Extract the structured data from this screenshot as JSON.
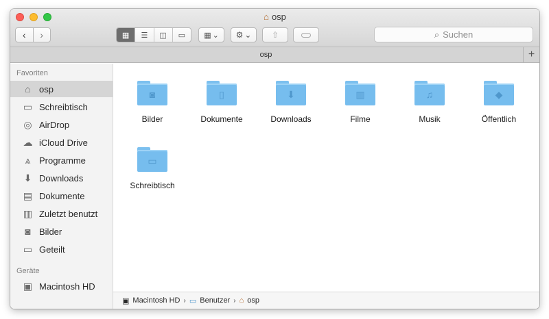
{
  "window": {
    "title": "osp"
  },
  "toolbar": {
    "back_glyph": "‹",
    "forward_glyph": "›",
    "search_placeholder": "Suchen"
  },
  "tabbar": {
    "label": "osp",
    "add_glyph": "+"
  },
  "sidebar": {
    "favorites_heading": "Favoriten",
    "devices_heading": "Geräte",
    "items": [
      {
        "label": "osp",
        "icon": "home-icon"
      },
      {
        "label": "Schreibtisch",
        "icon": "desktop-icon"
      },
      {
        "label": "AirDrop",
        "icon": "airdrop-icon"
      },
      {
        "label": "iCloud Drive",
        "icon": "cloud-icon"
      },
      {
        "label": "Programme",
        "icon": "applications-icon"
      },
      {
        "label": "Downloads",
        "icon": "downloads-icon"
      },
      {
        "label": "Dokumente",
        "icon": "documents-icon"
      },
      {
        "label": "Zuletzt benutzt",
        "icon": "recents-icon"
      },
      {
        "label": "Bilder",
        "icon": "camera-icon"
      },
      {
        "label": "Geteilt",
        "icon": "folder-icon"
      }
    ],
    "devices": [
      {
        "label": "Macintosh HD",
        "icon": "harddisk-icon"
      }
    ]
  },
  "content": {
    "items": [
      {
        "label": "Bilder",
        "icon": "camera-folder-icon"
      },
      {
        "label": "Dokumente",
        "icon": "document-folder-icon"
      },
      {
        "label": "Downloads",
        "icon": "download-folder-icon"
      },
      {
        "label": "Filme",
        "icon": "film-folder-icon"
      },
      {
        "label": "Musik",
        "icon": "music-folder-icon"
      },
      {
        "label": "Öffentlich",
        "icon": "public-folder-icon"
      },
      {
        "label": "Schreibtisch",
        "icon": "desktop-folder-icon"
      }
    ]
  },
  "pathbar": {
    "segments": [
      "Macintosh HD",
      "Benutzer",
      "osp"
    ]
  },
  "colors": {
    "folder": "#76bdee",
    "selection": "#d5d5d5",
    "close": "#fc5f57",
    "minimize": "#fdbc2e",
    "maximize": "#33c748"
  }
}
